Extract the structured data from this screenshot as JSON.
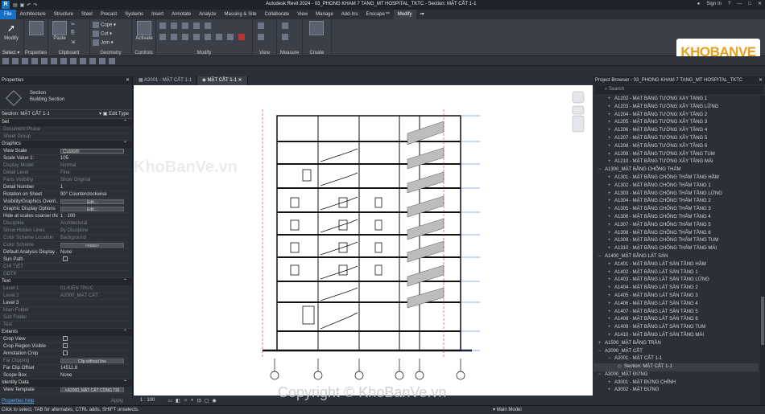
{
  "titlebar": {
    "app_icon": "R",
    "title": "Autodesk Revit 2024 - 03_PHONG KHAM 7 TANG_MT HOSPITAL_TKTC - Section: MẶT CẮT 1-1",
    "sign_in": "Sign In"
  },
  "tabs": [
    "File",
    "Architecture",
    "Structure",
    "Steel",
    "Precast",
    "Systems",
    "Insert",
    "Annotate",
    "Analyze",
    "Massing & Site",
    "Collaborate",
    "View",
    "Manage",
    "Add-Ins",
    "Enscape™",
    "Modify"
  ],
  "ribbon": {
    "modify": "Modify",
    "select": "Select ▾",
    "properties": "Properties",
    "clipboard": "Clipboard",
    "paste": "Paste",
    "cope": "Cope",
    "cut": "Cut",
    "join": "Join",
    "geometry": "Geometry",
    "activate": "Activate",
    "controls": "Controls",
    "modify_group": "Modify",
    "view": "View",
    "measure": "Measure",
    "create": "Create"
  },
  "properties": {
    "header": "Properties",
    "type_family": "Section",
    "type_name": "Building Section",
    "selector": "Section: MẶT CẮT 1-1",
    "edit_type": "Edit Type",
    "groups": {
      "set": "Set",
      "graphics": "Graphics",
      "text": "Text",
      "extents": "Extents",
      "identity": "Identity Data"
    },
    "set_rows": [
      [
        "Document Phase",
        ""
      ],
      [
        "Sheet Group",
        ""
      ]
    ],
    "graphics_rows": [
      [
        "View Scale",
        "Custom"
      ],
      [
        "Scale Value    1:",
        "105"
      ],
      [
        "Display Model",
        "Normal"
      ],
      [
        "Detail Level",
        "Fine"
      ],
      [
        "Parts Visibility",
        "Show Original"
      ],
      [
        "Detail Number",
        "1"
      ],
      [
        "Rotation on Sheet",
        "90° Counterclockwise"
      ],
      [
        "Visibility/Graphics Overri...",
        "Edit..."
      ],
      [
        "Graphic Display Options",
        "Edit..."
      ],
      [
        "Hide at scales coarser than",
        "1 : 100"
      ],
      [
        "Discipline",
        "Architectural"
      ],
      [
        "Show Hidden Lines",
        "By Discipline"
      ],
      [
        "Color Scheme Location",
        "Background"
      ],
      [
        "Color Scheme",
        "<none>"
      ],
      [
        "Default Analysis Display ...",
        "None"
      ],
      [
        "Sun Path",
        ""
      ],
      [
        "CHI TIẾT",
        ""
      ],
      [
        "GĐTK",
        ""
      ]
    ],
    "text_rows": [
      [
        "Level 1",
        "01-KIẾN TRÚC"
      ],
      [
        "Level 2",
        "A2000_MẶT CẮT"
      ],
      [
        "Level 3",
        ""
      ],
      [
        "Main Folder",
        ""
      ],
      [
        "Sub Folder",
        ""
      ],
      [
        "Text",
        ""
      ]
    ],
    "extents_rows": [
      [
        "Crop View",
        ""
      ],
      [
        "Crop Region Visible",
        ""
      ],
      [
        "Annotation Crop",
        ""
      ],
      [
        "Far Clipping",
        "Clip without line"
      ],
      [
        "Far Clip Offset",
        "14511.8"
      ],
      [
        "Scope Box",
        "None"
      ]
    ],
    "identity_rows": [
      [
        "View Template",
        "<A2000_MẶT CẮT CÔNG TRÌ"
      ]
    ],
    "help": "Properties help",
    "apply": "Apply"
  },
  "view_tabs": [
    "A2001 - MẶT CẮT 1-1",
    "MẶT CẮT 1-1"
  ],
  "viewbar": {
    "scale": "1 : 100"
  },
  "project_browser": {
    "header": "Project Browser - 03_PHONG KHAM 7 TANG_MT HOSPITAL_TKTC",
    "search": "Search",
    "items": [
      {
        "level": "l2",
        "exp": "+",
        "label": "A1202 - MẶT BẰNG TƯỜNG XÂY TẦNG 1"
      },
      {
        "level": "l2",
        "exp": "+",
        "label": "A1203 - MẶT BẰNG TƯỜNG XÂY TẦNG LỬNG"
      },
      {
        "level": "l2",
        "exp": "+",
        "label": "A1204 - MẶT BẰNG TƯỜNG XÂY TẦNG 2"
      },
      {
        "level": "l2",
        "exp": "+",
        "label": "A1205 - MẶT BẰNG TƯỜNG XÂY TẦNG 3"
      },
      {
        "level": "l2",
        "exp": "+",
        "label": "A1206 - MẶT BẰNG TƯỜNG XÂY TẦNG 4"
      },
      {
        "level": "l2",
        "exp": "+",
        "label": "A1207 - MẶT BẰNG TƯỜNG XÂY TẦNG 5"
      },
      {
        "level": "l2",
        "exp": "+",
        "label": "A1208 - MẶT BẰNG TƯỜNG XÂY TẦNG 6"
      },
      {
        "level": "l2",
        "exp": "+",
        "label": "A1209 - MẶT BẰNG TƯỜNG XÂY TẦNG TUM"
      },
      {
        "level": "l2",
        "exp": "+",
        "label": "A1210 - MẶT BẰNG TƯỜNG XÂY TẦNG MÁI"
      },
      {
        "level": "l0",
        "exp": "−",
        "label": "A1300_MẶT BẰNG CHỐNG THẤM"
      },
      {
        "level": "l2",
        "exp": "+",
        "label": "A1301 - MẶT BẰNG CHỐNG THẤM TẦNG HẦM"
      },
      {
        "level": "l2",
        "exp": "+",
        "label": "A1302 - MẶT BẰNG CHỐNG THẤM TẦNG 1"
      },
      {
        "level": "l2",
        "exp": "+",
        "label": "A1303 - MẶT BẰNG CHỐNG THẤM TẦNG LỬNG"
      },
      {
        "level": "l2",
        "exp": "+",
        "label": "A1304 - MẶT BẰNG CHỐNG THẤM TẦNG 2"
      },
      {
        "level": "l2",
        "exp": "+",
        "label": "A1305 - MẶT BẰNG CHỐNG THẤM TẦNG 3"
      },
      {
        "level": "l2",
        "exp": "+",
        "label": "A1306 - MẶT BẰNG CHỐNG THẤM TẦNG 4"
      },
      {
        "level": "l2",
        "exp": "+",
        "label": "A1307 - MẶT BẰNG CHỐNG THẤM TẦNG 5"
      },
      {
        "level": "l2",
        "exp": "+",
        "label": "A1308 - MẶT BẰNG CHỐNG THẤM TẦNG 6"
      },
      {
        "level": "l2",
        "exp": "+",
        "label": "A1309 - MẶT BẰNG CHỐNG THẤM TẦNG TUM"
      },
      {
        "level": "l2",
        "exp": "+",
        "label": "A1310 - MẶT BẰNG CHỐNG THẤM TẦNG MÁI"
      },
      {
        "level": "l0",
        "exp": "−",
        "label": "A1400_MẶT BẰNG LÁT SÀN"
      },
      {
        "level": "l2",
        "exp": "+",
        "label": "A1401 - MẶT BẰNG LÁT SÀN TẦNG HẦM"
      },
      {
        "level": "l2",
        "exp": "+",
        "label": "A1402 - MẶT BẰNG LÁT SÀN TẦNG 1"
      },
      {
        "level": "l2",
        "exp": "+",
        "label": "A1403 - MẶT BẰNG LÁT SÀN TẦNG LỬNG"
      },
      {
        "level": "l2",
        "exp": "+",
        "label": "A1404 - MẶT BẰNG LÁT SÀN TẦNG 2"
      },
      {
        "level": "l2",
        "exp": "+",
        "label": "A1405 - MẶT BẰNG LÁT SÀN TẦNG 3"
      },
      {
        "level": "l2",
        "exp": "+",
        "label": "A1406 - MẶT BẰNG LÁT SÀN TẦNG 4"
      },
      {
        "level": "l2",
        "exp": "+",
        "label": "A1407 - MẶT BẰNG LÁT SÀN TẦNG 5"
      },
      {
        "level": "l2",
        "exp": "+",
        "label": "A1408 - MẶT BẰNG LÁT SÀN TẦNG 6"
      },
      {
        "level": "l2",
        "exp": "+",
        "label": "A1409 - MẶT BẰNG LÁT SÀN TẦNG TUM"
      },
      {
        "level": "l2",
        "exp": "+",
        "label": "A1410 - MẶT BẰNG LÁT SÀN TẦNG MÁI"
      },
      {
        "level": "l0",
        "exp": "+",
        "label": "A1500_MẶT BẰNG TRẦN"
      },
      {
        "level": "l0",
        "exp": "−",
        "label": "A2000_MẶT CẮT"
      },
      {
        "level": "l2",
        "exp": "−",
        "label": "A2001 - MẶT CẮT 1-1"
      },
      {
        "level": "l3",
        "exp": "◇",
        "label": "Section: MẶT CẮT 1-1"
      },
      {
        "level": "l0",
        "exp": "−",
        "label": "A3000_MẶT ĐỨNG"
      },
      {
        "level": "l2",
        "exp": "+",
        "label": "A3001 - MẶT ĐỨNG CHÍNH"
      },
      {
        "level": "l2",
        "exp": "+",
        "label": "A3002 - MẶT ĐỨNG"
      }
    ]
  },
  "status": {
    "hint": "Click to select, TAB for alternates, CTRL adds, SHIFT unselects.",
    "model": "Main Model"
  },
  "watermarks": {
    "logo": "KHOBANVE",
    "center": "KhoBanVe.vn",
    "copyright": "Copyright © KhoBanVe.vn"
  },
  "colors": {
    "accent": "#1473c7",
    "bg": "#2b2f36",
    "ribbon": "#3b4048"
  }
}
